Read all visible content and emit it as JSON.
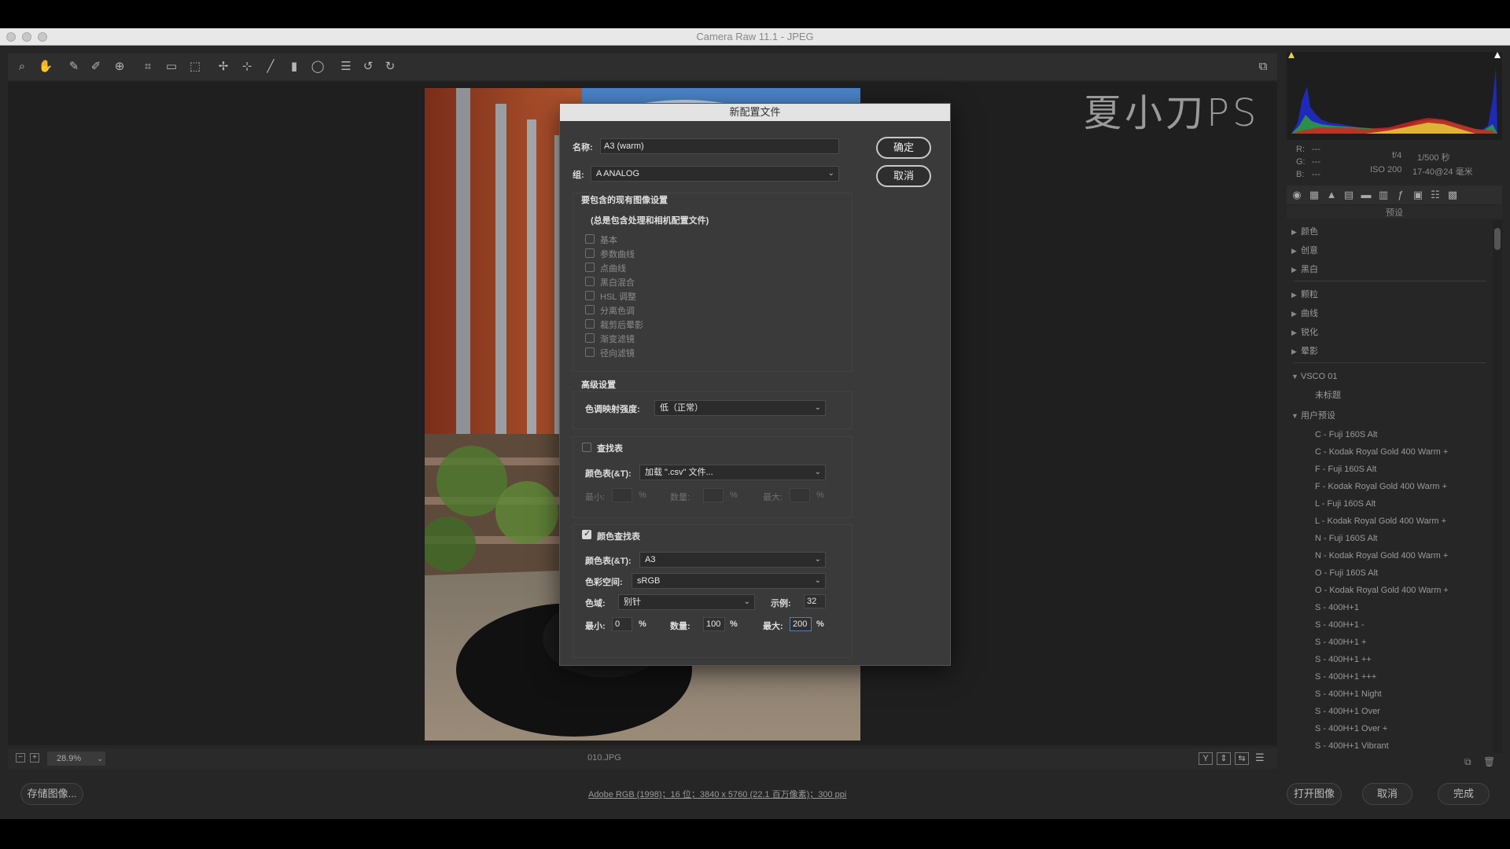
{
  "window": {
    "title": "Camera Raw 11.1 -  JPEG"
  },
  "watermark": "夏小刀PS",
  "toolbar": {
    "tools": [
      "zoom-icon",
      "hand-icon",
      "white-balance-icon",
      "color-sampler-icon",
      "target-adjust-icon",
      "crop-icon",
      "straighten-icon",
      "transform-icon",
      "spot-removal-icon",
      "red-eye-icon",
      "brush-icon",
      "graduated-filter-icon",
      "radial-filter-icon",
      "preferences-icon",
      "rotate-ccw-icon",
      "rotate-cw-icon"
    ],
    "right_icon": "fullscreen-icon"
  },
  "viewbar": {
    "zoom": "28.9%",
    "filename": "010.JPG"
  },
  "footer": {
    "save_button": "存储图像...",
    "workflow_link": "Adobe RGB (1998)；16 位；3840 x 5760 (22.1 百万像素)；300 ppi",
    "open_button": "打开图像",
    "cancel_button": "取消",
    "done_button": "完成"
  },
  "right_panel": {
    "rgb": {
      "r": "R:",
      "g": "G:",
      "b": "B:",
      "r_val": "---",
      "g_val": "---",
      "b_val": "---"
    },
    "exif": {
      "aperture": "f/4",
      "shutter": "1/500 秒",
      "iso": "ISO 200",
      "lens": "17-40@24 毫米"
    },
    "panel_title": "预设",
    "groups_collapsed": [
      "颜色",
      "创意",
      "黑白"
    ],
    "groups_collapsed2": [
      "颗粒",
      "曲线",
      "锐化",
      "晕影"
    ],
    "vsco_group": "VSCO 01",
    "vsco_items": [
      "未标题"
    ],
    "user_group": "用户预设",
    "user_items": [
      "C - Fuji 160S Alt",
      "C - Kodak Royal Gold 400 Warm +",
      "F - Fuji 160S Alt",
      "F - Kodak Royal Gold 400 Warm +",
      "L - Fuji 160S Alt",
      "L - Kodak Royal Gold 400 Warm +",
      "N - Fuji 160S Alt",
      "N - Kodak Royal Gold 400 Warm +",
      "O - Fuji 160S Alt",
      "O - Kodak Royal Gold 400 Warm +",
      "S - 400H+1",
      "S - 400H+1 -",
      "S - 400H+1 +",
      "S - 400H+1 ++",
      "S - 400H+1 +++",
      "S - 400H+1 Night",
      "S - 400H+1 Over",
      "S - 400H+1 Over +",
      "S - 400H+1 Vibrant"
    ]
  },
  "dialog": {
    "title": "新配置文件",
    "name_label": "名称:",
    "name_value": "A3 (warm)",
    "group_label": "组:",
    "group_value": "A ANALOG",
    "ok": "确定",
    "cancel": "取消",
    "include_title": "要包含的现有图像设置",
    "include_note": "(总是包含处理和相机配置文件)",
    "include_items": [
      "基本",
      "参数曲线",
      "点曲线",
      "黑白混合",
      "HSL 调整",
      "分离色调",
      "裁剪后晕影",
      "渐变滤镜",
      "径向滤镜"
    ],
    "advanced_title": "高级设置",
    "tonemap_label": "色调映射强度:",
    "tonemap_value": "低（正常）",
    "lookup": {
      "label": "查找表",
      "checked": false,
      "table_label": "颜色表(&T):",
      "table_value": "加载 \".csv\" 文件...",
      "min_label": "最小:",
      "amount_label": "数量:",
      "max_label": "最大:",
      "percent": "%"
    },
    "color_lookup": {
      "label": "颜色查找表",
      "checked": true,
      "table_label": "颜色表(&T):",
      "table_value": "A3",
      "space_label": "色彩空间:",
      "space_value": "sRGB",
      "gamut_label": "色域:",
      "gamut_value": "别针",
      "sample_label": "示例:",
      "sample_value": "32",
      "min_label": "最小:",
      "min_value": "0",
      "amount_label": "数量:",
      "amount_value": "100",
      "max_label": "最大:",
      "max_value": "200",
      "percent": "%"
    }
  }
}
